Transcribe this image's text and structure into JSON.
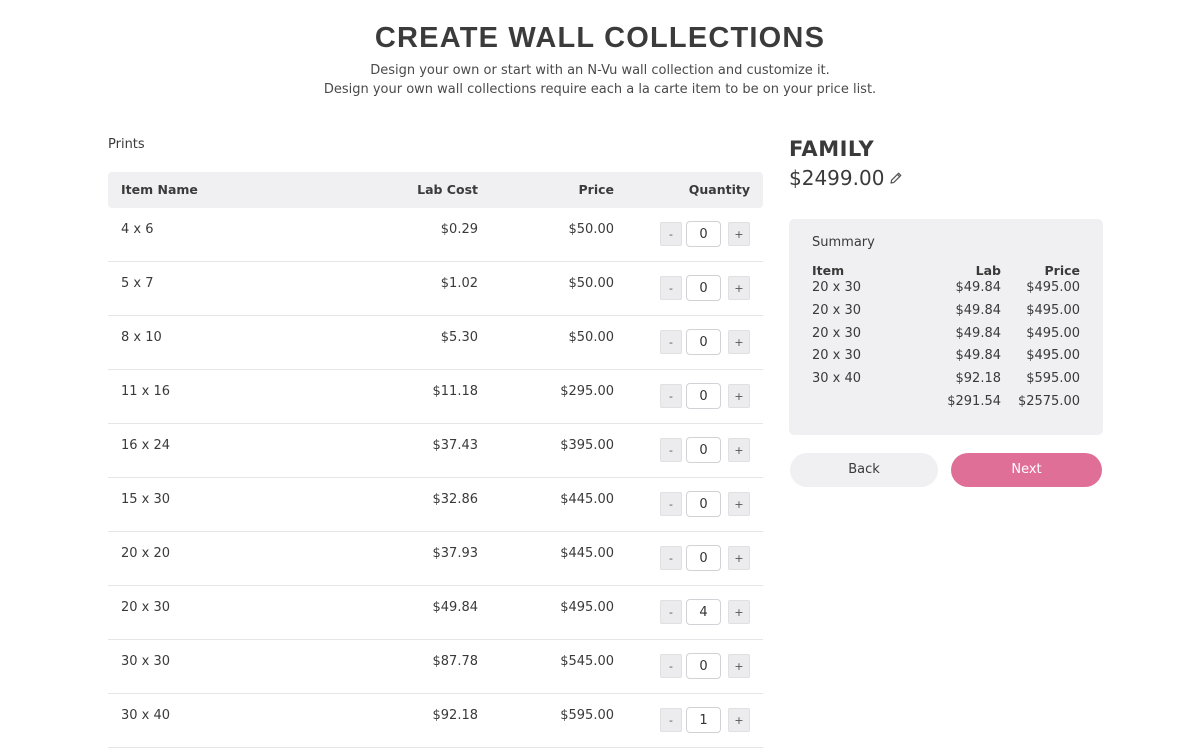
{
  "header": {
    "title": "CREATE WALL COLLECTIONS",
    "subtitle_line1": "Design your own or start with an N-Vu wall collection and customize it.",
    "subtitle_line2": "Design your own wall collections require each a la carte item to be on your price list."
  },
  "prints": {
    "section_label": "Prints",
    "columns": {
      "name": "Item Name",
      "cost": "Lab Cost",
      "price": "Price",
      "quantity": "Quantity"
    },
    "minus_label": "-",
    "plus_label": "+",
    "rows": [
      {
        "name": "4 x 6",
        "cost": "$0.29",
        "price": "$50.00",
        "qty": "0"
      },
      {
        "name": "5 x 7",
        "cost": "$1.02",
        "price": "$50.00",
        "qty": "0"
      },
      {
        "name": "8 x 10",
        "cost": "$5.30",
        "price": "$50.00",
        "qty": "0"
      },
      {
        "name": "11 x 16",
        "cost": "$11.18",
        "price": "$295.00",
        "qty": "0"
      },
      {
        "name": "16 x 24",
        "cost": "$37.43",
        "price": "$395.00",
        "qty": "0"
      },
      {
        "name": "15 x 30",
        "cost": "$32.86",
        "price": "$445.00",
        "qty": "0"
      },
      {
        "name": "20 x 20",
        "cost": "$37.93",
        "price": "$445.00",
        "qty": "0"
      },
      {
        "name": "20 x 30",
        "cost": "$49.84",
        "price": "$495.00",
        "qty": "4"
      },
      {
        "name": "30 x 30",
        "cost": "$87.78",
        "price": "$545.00",
        "qty": "0"
      },
      {
        "name": "30 x 40",
        "cost": "$92.18",
        "price": "$595.00",
        "qty": "1"
      }
    ]
  },
  "collection": {
    "name": "FAMILY",
    "price": "$2499.00",
    "edit_icon": "pencil-icon"
  },
  "summary": {
    "title": "Summary",
    "columns": {
      "item": "Item",
      "lab": "Lab",
      "price": "Price"
    },
    "rows": [
      {
        "item": "20 x 30",
        "lab": "$49.84",
        "price": "$495.00"
      },
      {
        "item": "20 x 30",
        "lab": "$49.84",
        "price": "$495.00"
      },
      {
        "item": "20 x 30",
        "lab": "$49.84",
        "price": "$495.00"
      },
      {
        "item": "20 x 30",
        "lab": "$49.84",
        "price": "$495.00"
      },
      {
        "item": "30 x 40",
        "lab": "$92.18",
        "price": "$595.00"
      }
    ],
    "totals": {
      "lab": "$291.54",
      "price": "$2575.00"
    }
  },
  "actions": {
    "back_label": "Back",
    "next_label": "Next"
  },
  "colors": {
    "accent": "#e06f97",
    "panel": "#f0f0f2"
  }
}
